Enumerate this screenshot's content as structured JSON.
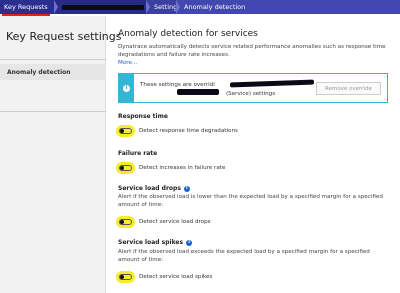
{
  "breadcrumb": {
    "items": [
      "Key Requests",
      "",
      "Settings",
      "Anomaly detection"
    ]
  },
  "sidebar": {
    "title": "Key Request settings",
    "items": [
      {
        "label": "Anomaly detection",
        "selected": true
      }
    ]
  },
  "main": {
    "title": "Anomaly detection for services",
    "description": "Dynatrace automatically detects service related performance anomalies such as response time degradations and failure rate increases.",
    "more_link": "More...",
    "notice": {
      "icon": "info-icon",
      "line1": "These settings are overridi",
      "line2": "(Service) settings",
      "button": "Remove override"
    },
    "sections": [
      {
        "title": "Response time",
        "toggle_label": "Detect response time degradations",
        "enabled": false
      },
      {
        "title": "Failure rate",
        "toggle_label": "Detect increases in failure rate",
        "enabled": false
      },
      {
        "title": "Service load drops",
        "description": "Alert if the observed load is lower than the expected load by a specified margin for a specified amount of time:",
        "toggle_label": "Detect service load drops",
        "enabled": false
      },
      {
        "title": "Service load spikes",
        "description": "Alert if the observed load exceeds the expected load by a specified margin for a specified amount of time:",
        "toggle_label": "Detect service load spikes",
        "enabled": false
      }
    ]
  },
  "colors": {
    "breadcrumb_bg": "#2a2f8f",
    "info_accent": "#34b5d5",
    "link": "#1a63c5",
    "highlight": "#f6ec2a",
    "active_underline": "#e41f27"
  }
}
